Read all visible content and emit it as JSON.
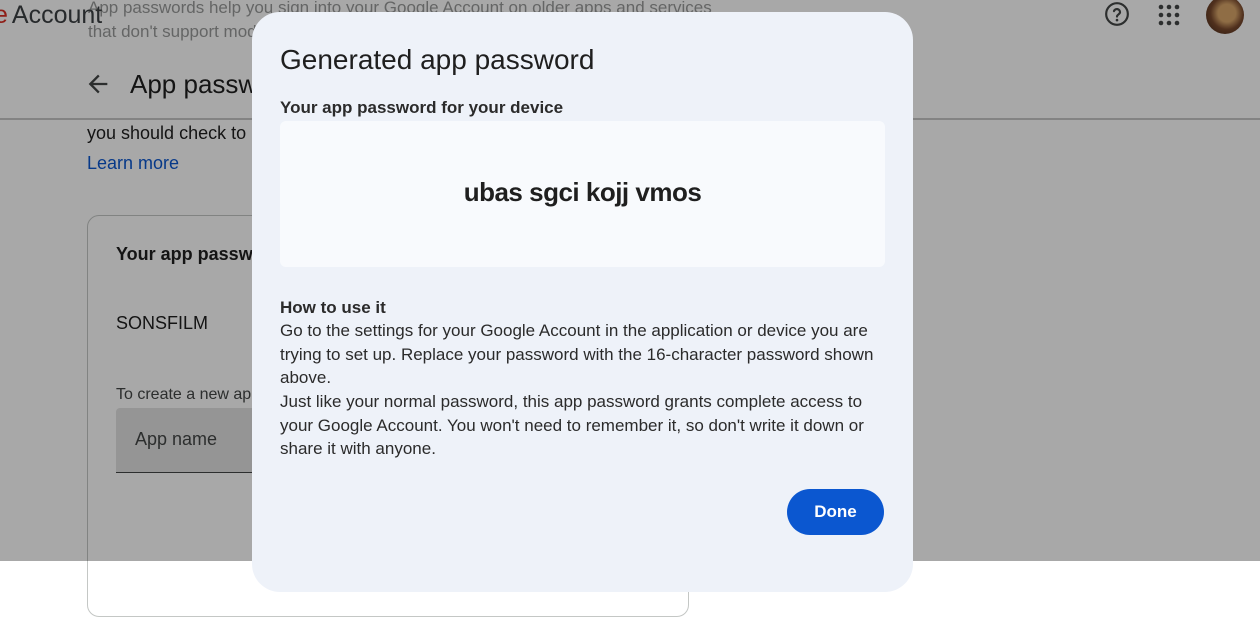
{
  "background": {
    "brand_prefix": "e",
    "brand_name": "Account",
    "page_title": "App passwords",
    "ghost_header_text": "App passwords help you sign into your Google Account on older apps and services that don't support modern security standards.",
    "body_text": "you should check to",
    "learn_more_label": "Learn more",
    "card_heading": "Your app passwords",
    "app_entry_name": "SONSFILM",
    "create_hint": "To create a new app specific password, type a name for it below...",
    "app_name_placeholder": "App name",
    "icons": {
      "back": "arrow-back-icon",
      "help": "help-circle-icon",
      "apps": "apps-grid-icon",
      "avatar": "account-avatar"
    }
  },
  "dialog": {
    "title": "Generated app password",
    "subtitle": "Your app password for your device",
    "password": "ubas sgci kojj vmos",
    "howto_title": "How to use it",
    "howto_paragraph_1": "Go to the settings for your Google Account in the application or device you are trying to set up. Replace your password with the 16-character password shown above.",
    "howto_paragraph_2": "Just like your normal password, this app password grants complete access to your Google Account. You won't need to remember it, so don't write it down or share it with anyone.",
    "done_label": "Done"
  },
  "colors": {
    "accent": "#0b57d0",
    "dialog_bg": "#eef2f9",
    "password_box_bg": "#f8fafd",
    "scrim": "rgba(0,0,0,0.34)",
    "brand_red": "#d93025"
  }
}
